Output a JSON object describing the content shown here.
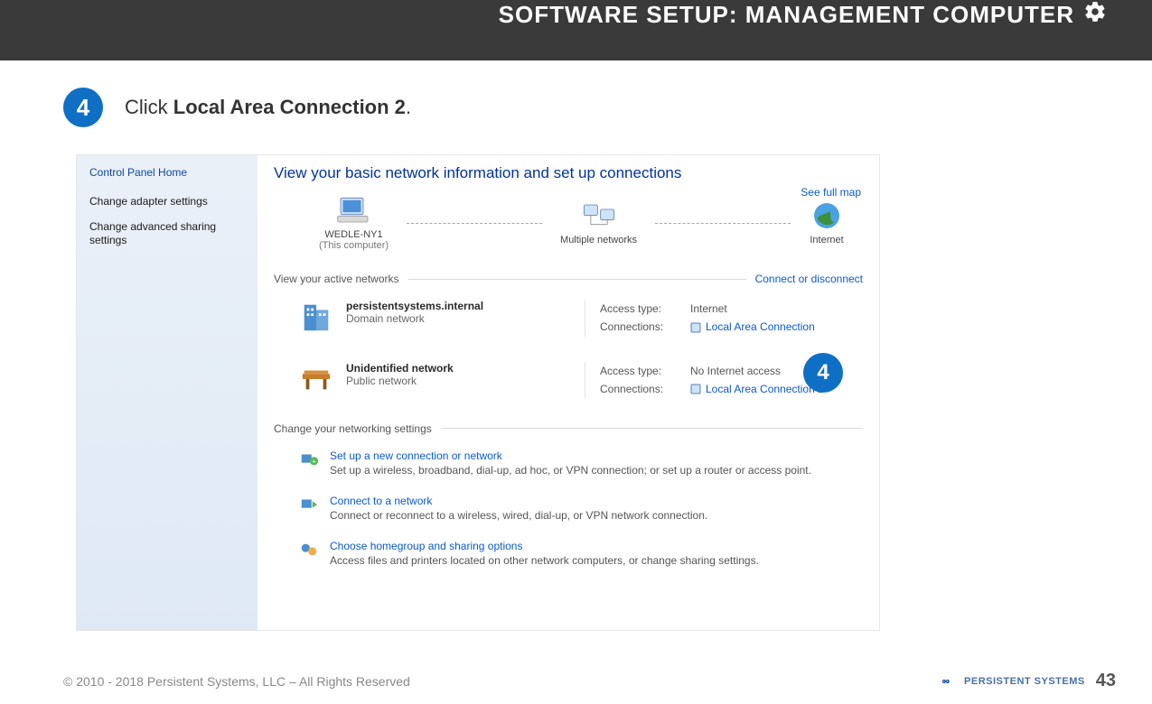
{
  "header": {
    "title": "SOFTWARE SETUP:  MANAGEMENT COMPUTER"
  },
  "step": {
    "number": "4",
    "prefix": "Click ",
    "bold": "Local Area Connection 2",
    "suffix": "."
  },
  "callout": {
    "number": "4"
  },
  "sidebar": {
    "home": "Control Panel Home",
    "link1": "Change adapter settings",
    "link2": "Change advanced sharing settings"
  },
  "panel": {
    "heading": "View your basic network information and set up connections",
    "see_full_map": "See full map",
    "map": {
      "pc_name": "WEDLE-NY1",
      "pc_sub": "(This computer)",
      "multi": "Multiple networks",
      "internet": "Internet"
    },
    "active_label": "View your active networks",
    "connect_or_disconnect": "Connect or disconnect",
    "net1": {
      "name": "persistentsystems.internal",
      "type": "Domain network",
      "access_k": "Access type:",
      "access_v": "Internet",
      "conn_k": "Connections:",
      "conn_v": "Local Area Connection"
    },
    "net2": {
      "name": "Unidentified network",
      "type": "Public network",
      "access_k": "Access type:",
      "access_v": "No Internet access",
      "conn_k": "Connections:",
      "conn_v": "Local Area Connection 2"
    },
    "change_label": "Change your networking settings",
    "opts": [
      {
        "title": "Set up a new connection or network",
        "desc": "Set up a wireless, broadband, dial-up, ad hoc, or VPN connection; or set up a router or access point."
      },
      {
        "title": "Connect to a network",
        "desc": "Connect or reconnect to a wireless, wired, dial-up, or VPN network connection."
      },
      {
        "title": "Choose homegroup and sharing options",
        "desc": "Access files and printers located on other network computers, or change sharing settings."
      }
    ]
  },
  "footer": {
    "copyright": "© 2010 - 2018 Persistent Systems, LLC – All Rights Reserved",
    "logo_text": "PERSISTENT SYSTEMS",
    "page": "43"
  }
}
